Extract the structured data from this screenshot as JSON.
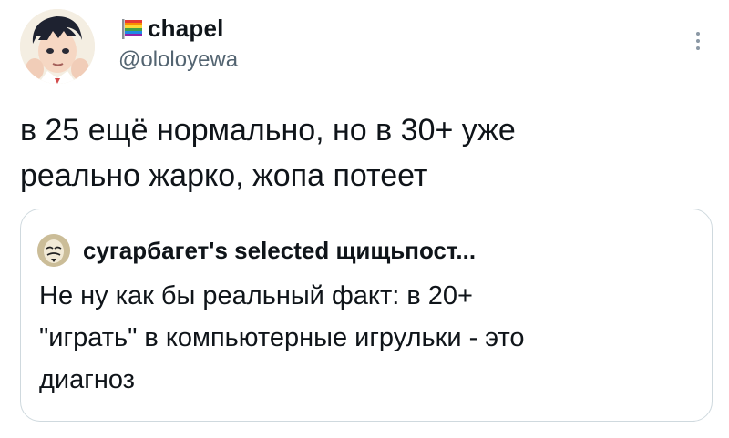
{
  "tweet": {
    "author": {
      "display_name": "chapel",
      "handle": "@ololoyewa",
      "name_emoji_icon": "rainbow-flag-icon",
      "avatar_icon": "anime-character-avatar"
    },
    "more_icon": "vertical-ellipsis-icon",
    "text": "в 25 ещё нормально, но в 30+ уже\nреально жарко, жопа потеет"
  },
  "quoted_tweet": {
    "author_name": "сугарбагет's selected щищьпост...",
    "avatar_icon": "masked-face-avatar",
    "text": "Не ну как бы реальный факт: в 20+\n\"играть\" в компьютерные игрульки - это\nдиагноз"
  },
  "colors": {
    "text_primary": "#0f1419",
    "text_secondary": "#536471",
    "border": "#cfd9de",
    "background": "#ffffff"
  }
}
